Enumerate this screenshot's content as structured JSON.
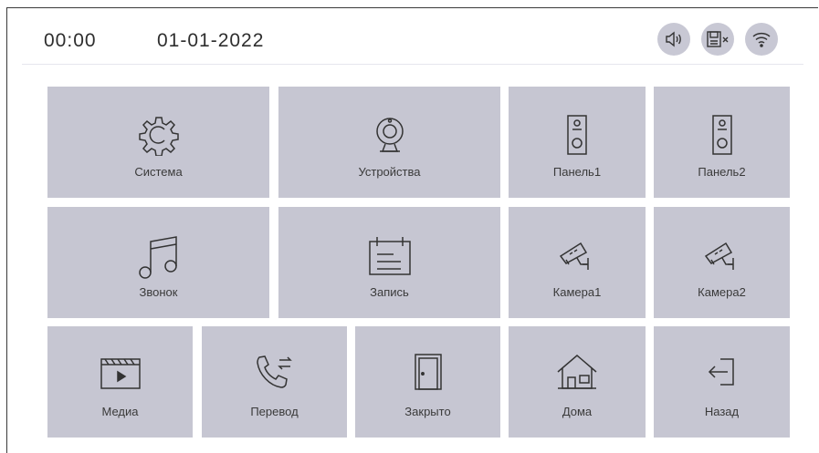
{
  "status_bar": {
    "time": "00:00",
    "date": "01-01-2022",
    "icons": [
      "speaker-icon",
      "sd-card-error-icon",
      "wifi-icon"
    ]
  },
  "menu": {
    "sistema": "Система",
    "ustroystva": "Устройства",
    "panel1": "Панель1",
    "panel2": "Панель2",
    "zvonok": "Звонок",
    "zapis": "Запись",
    "kamera1": "Камера1",
    "kamera2": "Камера2",
    "media": "Медиа",
    "perevod": "Перевод",
    "zakryto": "Закрыто",
    "doma": "Дома",
    "nazad": "Назад"
  },
  "colors": {
    "tile": "#c6c6d2",
    "status_circle": "#c8c8d4",
    "icon_stroke": "#333333"
  }
}
